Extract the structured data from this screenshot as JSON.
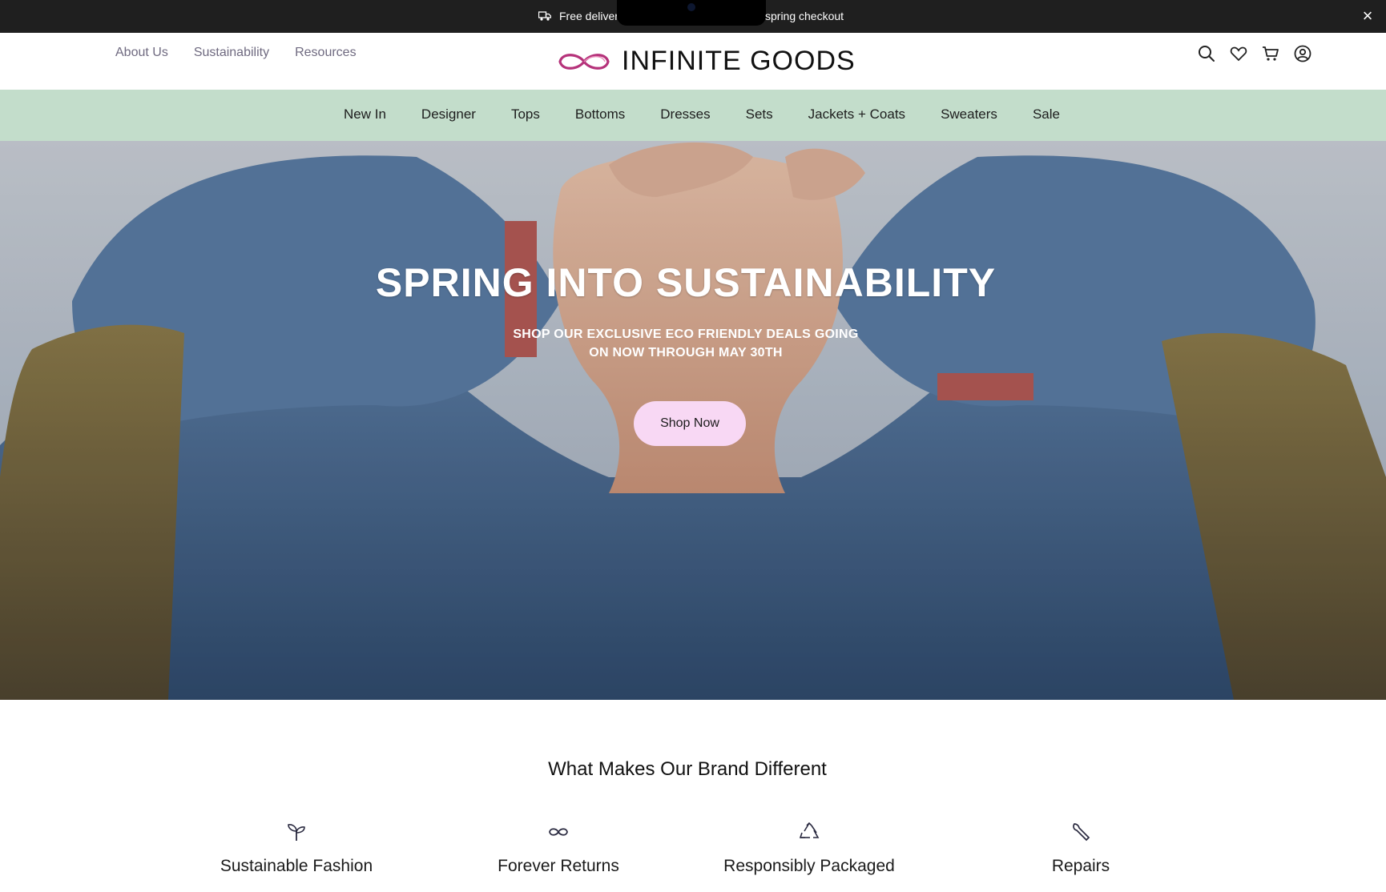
{
  "announcement": {
    "text_left": "Free deliver",
    "text_right": "spring checkout",
    "icon": "delivery-truck-icon",
    "close_icon": "close-icon"
  },
  "header": {
    "top_links": [
      "About Us",
      "Sustainability",
      "Resources"
    ],
    "logo_text": "INFINITE GOODS",
    "logo_icon": "infinity-icon",
    "icons": [
      "search-icon",
      "heart-icon",
      "cart-icon",
      "account-icon"
    ]
  },
  "nav": {
    "items": [
      "New In",
      "Designer",
      "Tops",
      "Bottoms",
      "Dresses",
      "Sets",
      "Jackets + Coats",
      "Sweaters",
      "Sale"
    ]
  },
  "hero": {
    "title": "SPRING INTO SUSTAINABILITY",
    "subtitle_line1": "SHOP OUR EXCLUSIVE ECO FRIENDLY DEALS GOING",
    "subtitle_line2": "ON NOW THROUGH MAY 30TH",
    "cta_label": "Shop Now"
  },
  "brand_section": {
    "title": "What Makes Our Brand Different",
    "features": [
      {
        "icon": "sprout-icon",
        "name": "Sustainable Fashion"
      },
      {
        "icon": "infinity-icon",
        "name": "Forever Returns"
      },
      {
        "icon": "recycle-icon",
        "name": "Responsibly Packaged"
      },
      {
        "icon": "wrench-icon",
        "name": "Repairs"
      }
    ]
  },
  "colors": {
    "announcement_bg": "#1f1f1f",
    "nav_bg": "#c3ddcb",
    "cta_bg": "#f8d8f4",
    "logo_accent": "#b5327a"
  }
}
